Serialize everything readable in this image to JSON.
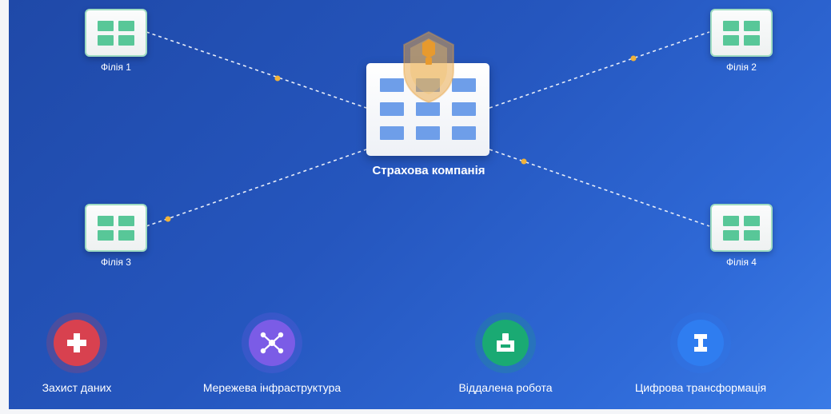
{
  "diagram": {
    "hq_label": "Страхова компанія",
    "branches": [
      {
        "label": "Філія 1"
      },
      {
        "label": "Філія 2"
      },
      {
        "label": "Філія 3"
      },
      {
        "label": "Філія 4"
      }
    ]
  },
  "features": [
    {
      "label": "Захист даних",
      "icon": "plus-icon",
      "color": "#d8414f"
    },
    {
      "label": "Мережева інфраструктура",
      "icon": "network-nodes-icon",
      "color": "#7b5ce6"
    },
    {
      "label": "Віддалена робота",
      "icon": "remote-terminal-icon",
      "color": "#1aaa73"
    },
    {
      "label": "Цифрова трансформація",
      "icon": "i-beam-icon",
      "color": "#2f7df0"
    }
  ],
  "colors": {
    "background": "#2556be",
    "branch_window": "#58c798",
    "hq_window": "#6e9ee9",
    "link_dot": "#f0b23a",
    "shield": "#e79a2e"
  }
}
